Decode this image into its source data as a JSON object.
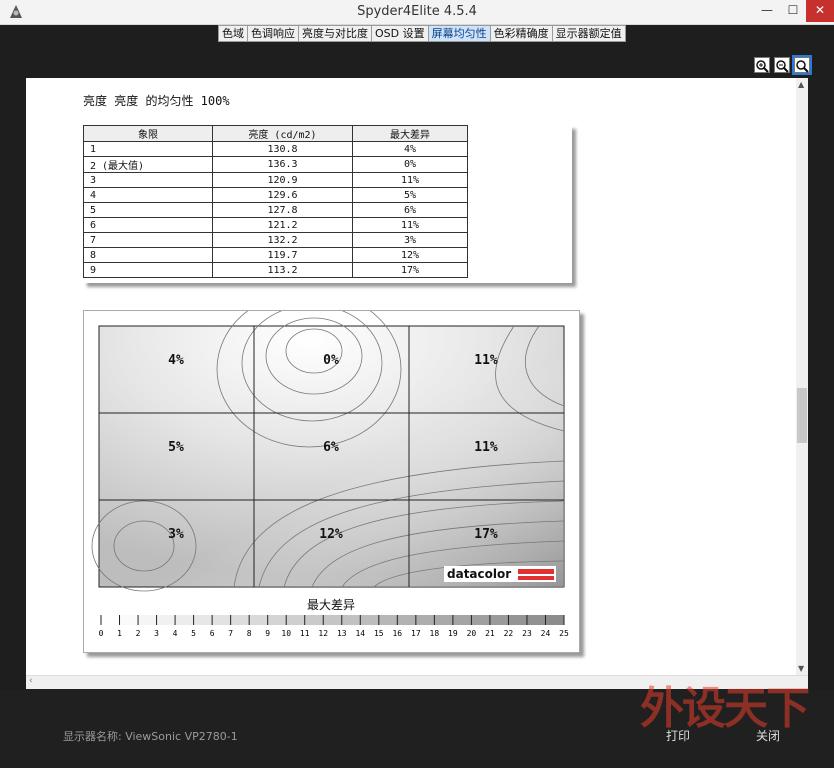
{
  "window": {
    "title": "Spyder4Elite 4.5.4",
    "minimize": "—",
    "maximize": "☐",
    "close": "✕"
  },
  "tabs": [
    {
      "label": "色域",
      "active": false
    },
    {
      "label": "色调响应",
      "active": false
    },
    {
      "label": "亮度与对比度",
      "active": false
    },
    {
      "label": "OSD 设置",
      "active": false
    },
    {
      "label": "屏幕均匀性",
      "active": true
    },
    {
      "label": "色彩精确度",
      "active": false
    },
    {
      "label": "显示器额定值",
      "active": false
    }
  ],
  "report": {
    "heading": "亮度 亮度 的均匀性 100%",
    "table": {
      "headers": [
        "象限",
        "亮度 (cd/m2)",
        "最大差异"
      ],
      "rows": [
        [
          "1",
          "130.8",
          "4%"
        ],
        [
          "2 (最大值)",
          "136.3",
          "0%"
        ],
        [
          "3",
          "120.9",
          "11%"
        ],
        [
          "4",
          "129.6",
          "5%"
        ],
        [
          "5",
          "127.8",
          "6%"
        ],
        [
          "6",
          "121.2",
          "11%"
        ],
        [
          "7",
          "132.2",
          "3%"
        ],
        [
          "8",
          "119.7",
          "12%"
        ],
        [
          "9",
          "113.2",
          "17%"
        ]
      ]
    },
    "grid_labels": [
      "4%",
      "0%",
      "11%",
      "5%",
      "6%",
      "11%",
      "3%",
      "12%",
      "17%"
    ],
    "brand": "datacolor",
    "legend_title": "最大差异",
    "legend_ticks": [
      "0",
      "1",
      "2",
      "3",
      "4",
      "5",
      "6",
      "7",
      "8",
      "9",
      "10",
      "11",
      "12",
      "13",
      "14",
      "15",
      "16",
      "17",
      "18",
      "19",
      "20",
      "21",
      "22",
      "23",
      "24",
      "25"
    ]
  },
  "footer": {
    "monitor_label": "显示器名称: ViewSonic VP2780-1",
    "print": "打印",
    "close": "关闭"
  },
  "watermark": "外设天下",
  "colors": {
    "active_tab": "#cfe3f8",
    "brand_red": "#e03030"
  }
}
